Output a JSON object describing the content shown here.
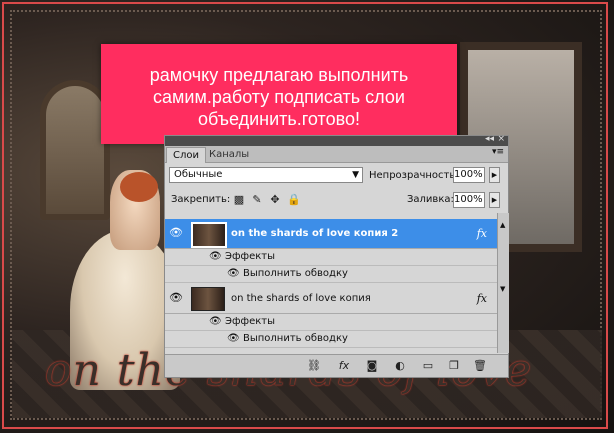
{
  "note": {
    "line1": "рамочку предлагаю выполнить",
    "line2": "самим.работу подписать слои",
    "line3": "объединить.готово!"
  },
  "watermark": "on the shards of love",
  "panel": {
    "tabs": [
      {
        "label": "Слои"
      },
      {
        "label": "Каналы"
      }
    ],
    "blend_mode": "Обычные",
    "opacity_label": "Непрозрачность:",
    "opacity_value": "100%",
    "lock_label": "Закрепить:",
    "fill_label": "Заливка:",
    "fill_value": "100%",
    "layers": [
      {
        "name": "on the shards of love копия 2",
        "selected": true,
        "fx": "fx"
      },
      {
        "name": "on the shards of love копия",
        "selected": false,
        "fx": "fx"
      }
    ],
    "effects_label": "Эффекты",
    "stroke_label": "Выполнить обводку"
  },
  "colors": {
    "note_bg": "#ff2d5f",
    "selection": "#3d8ee8",
    "border": "#d94a4a"
  }
}
